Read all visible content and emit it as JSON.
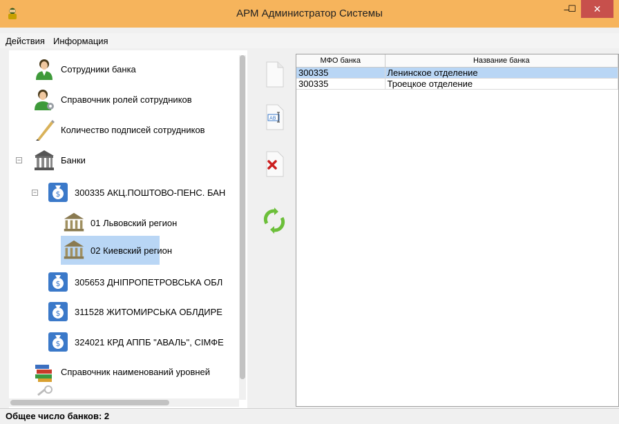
{
  "window": {
    "title": "АРМ Администратор Системы",
    "close_label": "✕",
    "min_label": "–",
    "max_label": "☐"
  },
  "menu": [
    "Действия",
    "Информация"
  ],
  "tree": {
    "items": [
      {
        "label": "Сотрудники банка",
        "icon": "employees-icon"
      },
      {
        "label": "Справочник ролей сотрудников",
        "icon": "roles-icon"
      },
      {
        "label": "Количество подписей сотрудников",
        "icon": "signature-pen-icon"
      },
      {
        "label": "Банки",
        "icon": "bank-building-icon",
        "toggle": "−"
      },
      {
        "label": "300335 АКЦ.ПОШТОВО-ПЕНС. БАН",
        "icon": "money-bag-icon",
        "toggle": "−"
      },
      {
        "label": "01 Львовский регион",
        "icon": "bank-small-icon"
      },
      {
        "label": "02 Киевский регион",
        "icon": "bank-small-icon",
        "selected": true
      },
      {
        "label": "305653 ДНІПРОПЕТРОВСЬКА ОБЛ",
        "icon": "money-bag-icon"
      },
      {
        "label": "311528 ЖИТОМИРСЬКА ОБЛДИРЕ",
        "icon": "money-bag-icon"
      },
      {
        "label": "324021 КРД АППБ \"АВАЛЬ\", СІМФЕ",
        "icon": "money-bag-icon"
      },
      {
        "label": "Справочник наименований уровней",
        "icon": "books-icon"
      }
    ]
  },
  "table": {
    "headers": [
      "МФО банка",
      "Название банка"
    ],
    "rows": [
      [
        "300335",
        "Ленинское отделение"
      ],
      [
        "300335",
        "Троецкое отделение"
      ]
    ]
  },
  "status": "Общее число банков: 2",
  "colors": {
    "titlebar": "#f6b45c",
    "selection": "#b9d6f5",
    "close": "#c7504c"
  }
}
